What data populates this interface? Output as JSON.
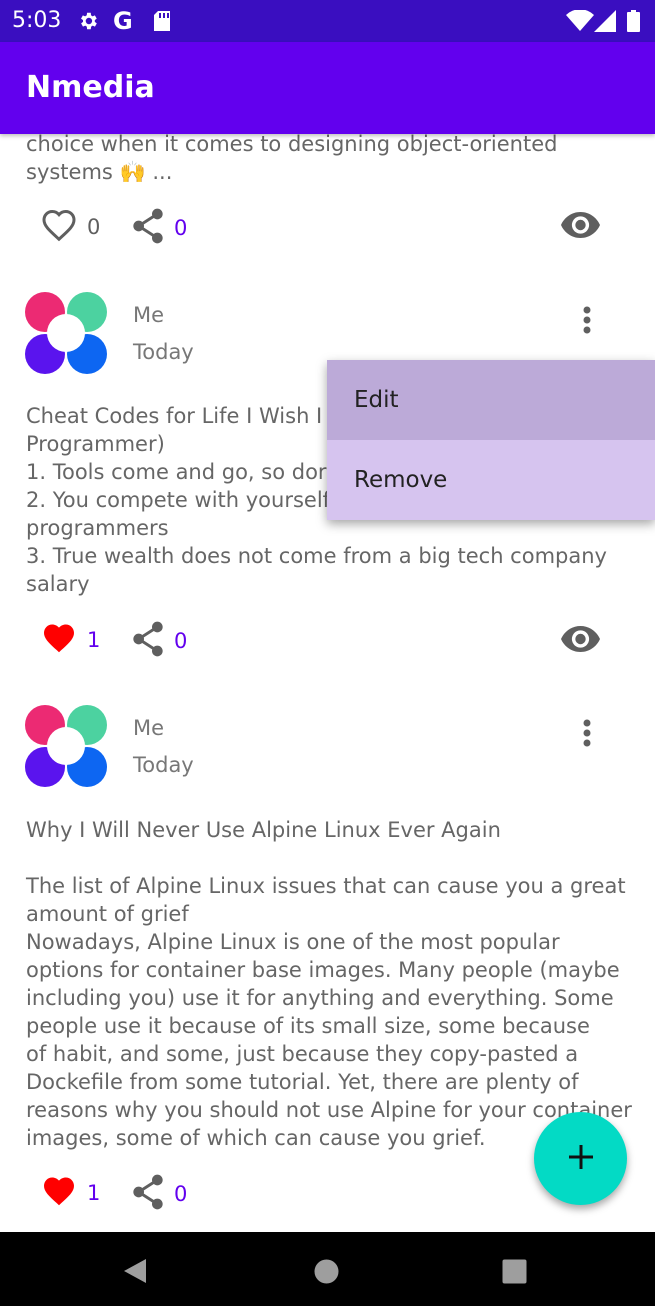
{
  "status_bar": {
    "time": "5:03",
    "icons": [
      "gear-icon",
      "google-g-icon",
      "sd-card-icon",
      "wifi-icon",
      "signal-icon",
      "battery-icon"
    ]
  },
  "app_bar": {
    "title": "Nmedia"
  },
  "posts": [
    {
      "text": "choice when it comes to designing object-oriented\nsystems 🙌 ...",
      "likes": "0",
      "liked": false,
      "shares": "0"
    },
    {
      "author": "Me",
      "date": "Today",
      "text": "Cheat Codes for Life I Wish I\nProgrammer)\n1. Tools come and go, so dor\n2. You compete with yourself\nprogrammers\n3. True wealth does not come from a big tech company\nsalary",
      "likes": "1",
      "liked": true,
      "shares": "0"
    },
    {
      "author": "Me",
      "date": "Today",
      "text": "Why I Will Never Use Alpine Linux Ever Again\n\nThe list of Alpine Linux issues that can cause you a great\namount of grief\nNowadays, Alpine Linux is one of the most popular\noptions for container base images. Many people (maybe\nincluding you) use it for anything and everything. Some\npeople use it because of its small size, some because\nof habit, and some, just because they copy-pasted a\nDockefile from some tutorial. Yet, there are plenty of\nreasons why you should not use Alpine for your container\nimages, some of which can cause you grief.",
      "likes": "1",
      "liked": true,
      "shares": "0"
    }
  ],
  "popup_menu": {
    "items": [
      "Edit",
      "Remove"
    ]
  },
  "colors": {
    "status_bar": "#3a0ec0",
    "primary": "#6200ee",
    "fab": "#03dac5",
    "like_active": "#ff0000",
    "popup": "#d6c4ef"
  }
}
